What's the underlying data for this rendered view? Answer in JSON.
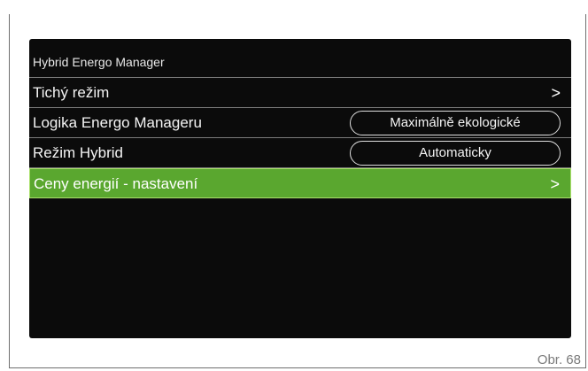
{
  "screen": {
    "title": "Hybrid Energo Manager",
    "rows": [
      {
        "label": "Tichý režim",
        "value": "",
        "arrow": ">"
      },
      {
        "label": "Logika Energo Manageru",
        "value": "Maximálně ekologické",
        "arrow": ""
      },
      {
        "label": "Režim Hybrid",
        "value": "Automaticky",
        "arrow": ""
      },
      {
        "label": "Ceny energií - nastavení",
        "value": "",
        "arrow": ">",
        "selected": true
      }
    ]
  },
  "figure_label": "Obr. 68",
  "colors": {
    "screen_bg": "#0b0b0b",
    "highlight": "#5aa72f",
    "highlight_border": "#a9e06a"
  }
}
